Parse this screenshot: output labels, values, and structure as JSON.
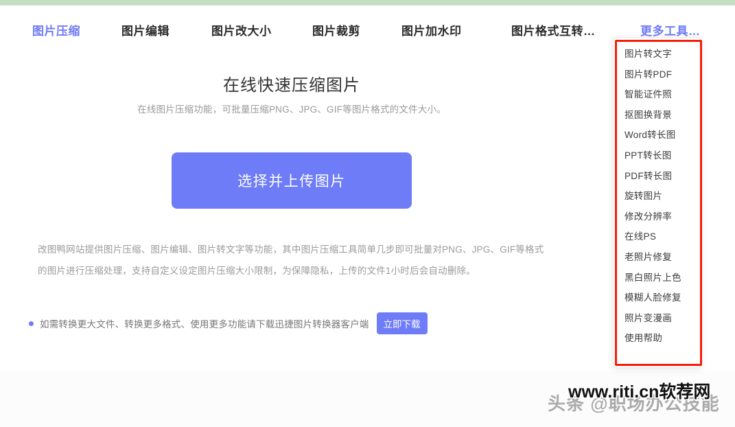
{
  "theme": {
    "accent": "#6f7cf7",
    "top_band": "#c6dfc4",
    "annotation": "#f61c08",
    "nav_text": "#2b2b2b",
    "body_text": "#9b9b9b"
  },
  "nav": {
    "items": [
      {
        "label": "图片压缩",
        "active": true
      },
      {
        "label": "图片编辑",
        "active": false
      },
      {
        "label": "图片改大小",
        "active": false
      },
      {
        "label": "图片裁剪",
        "active": false
      },
      {
        "label": "图片加水印",
        "active": false
      },
      {
        "label": "图片格式互转…",
        "active": false
      },
      {
        "label": "更多工具…",
        "active": true
      }
    ]
  },
  "dropdown": {
    "items": [
      {
        "label": "图片转文字"
      },
      {
        "label": "图片转PDF"
      },
      {
        "label": "智能证件照"
      },
      {
        "label": "抠图换背景"
      },
      {
        "label": "Word转长图"
      },
      {
        "label": "PPT转长图"
      },
      {
        "label": "PDF转长图"
      },
      {
        "label": "旋转图片"
      },
      {
        "label": "修改分辨率"
      },
      {
        "label": "在线PS"
      },
      {
        "label": "老照片修复"
      },
      {
        "label": "黑白照片上色"
      },
      {
        "label": "模糊人脸修复"
      },
      {
        "label": "照片变漫画"
      },
      {
        "label": "使用帮助"
      }
    ]
  },
  "hero": {
    "title": "在线快速压缩图片",
    "subtitle": "在线图片压缩功能，可批量压缩PNG、JPG、GIF等图片格式的文件大小。",
    "upload_button": "选择并上传图片"
  },
  "description": {
    "text": "改图鸭网站提供图片压缩、图片编辑、图片转文字等功能，其中图片压缩工具简单几步即可批量对PNG、JPG、GIF等格式的图片进行压缩处理，支持自定义设定图片压缩大小限制，为保障隐私，上传的文件1小时后会自动删除。"
  },
  "notice": {
    "bullet_icon": "bullet-dot-icon",
    "text": "如需转换更大文件、转换更多格式、使用更多功能请下载迅捷图片转换器客户端",
    "download_button": "立即下载"
  },
  "watermarks": {
    "front": "www.riti.cn软荐网",
    "back": "头条 @职场办公技能"
  }
}
